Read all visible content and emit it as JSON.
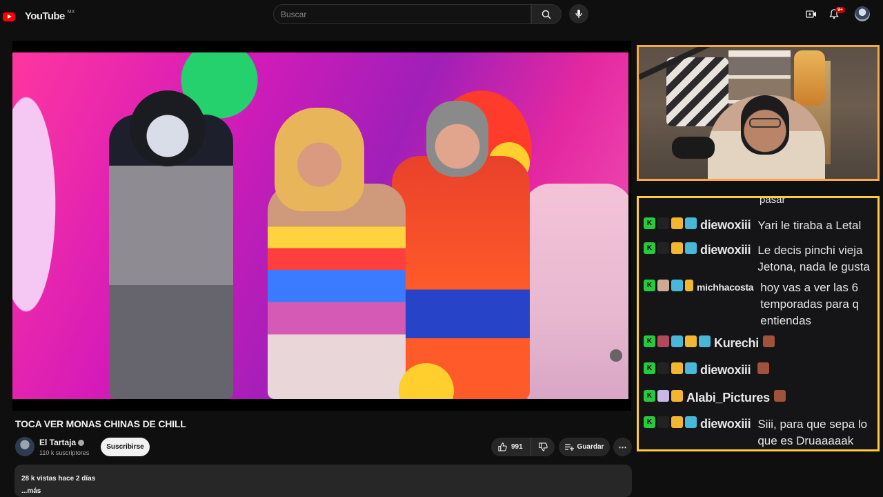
{
  "header": {
    "logo_text": "YouTube",
    "logo_country": "MX",
    "search_placeholder": "Buscar",
    "notification_count": "9+",
    "icons": [
      "youtube-logo-icon",
      "search-icon",
      "mic-icon",
      "create-video-icon",
      "bell-icon",
      "account-avatar"
    ]
  },
  "video": {
    "title": "TOCA VER MONAS CHINAS DE CHILL"
  },
  "channel": {
    "name": "El Tartaja",
    "subscribers": "110 k suscriptores",
    "subscribe_label": "Suscribirse"
  },
  "actions": {
    "likes": "991",
    "save_label": "Guardar",
    "more_label": "⋯"
  },
  "description": {
    "views_and_date": "28 k vistas  hace 2 días",
    "more_label": "...más"
  },
  "chat": {
    "cutoff_text": "pasar",
    "messages": [
      {
        "user": "diewoxiii",
        "text": "Yari le tiraba a Letal"
      },
      {
        "user": "diewoxiii",
        "text_line1": "Le decis pinchi vieja",
        "text_line2": "Jetona, nada le gusta"
      },
      {
        "user": "michhacosta",
        "text_line1": "hoy vas a ver las 6",
        "text_line2": "temporadas para q",
        "text_line3": "entiendas"
      },
      {
        "user": "Kurechi",
        "text": ""
      },
      {
        "user": "diewoxiii",
        "text": ""
      },
      {
        "user": "Alabi_Pictures",
        "text": ""
      },
      {
        "user": "diewoxiii",
        "text_line1": "Siii, para que sepa lo",
        "text_line2": "que es Druaaaaak"
      }
    ]
  },
  "colors": {
    "background": "#0f0f0f",
    "cam_border": "#f5a94a",
    "chat_border": "#ffcc3c",
    "brand_red": "#ff0000"
  }
}
